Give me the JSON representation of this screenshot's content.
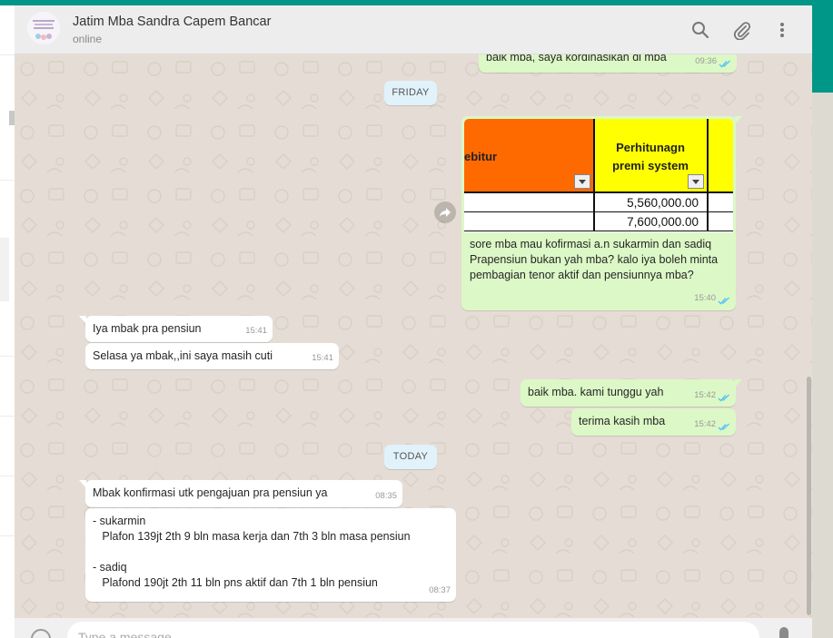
{
  "header": {
    "contact_name": "Jatim Mba Sandra Capem Bancar",
    "status": "online"
  },
  "icons": {
    "search": "search-icon",
    "attach": "paperclip-icon",
    "menu": "more-vertical-icon",
    "share": "forward-icon",
    "emoji": "emoji-icon",
    "mic": "microphone-icon"
  },
  "colors": {
    "teal": "#009688",
    "outgoing": "#dcf8c6",
    "incoming": "#ffffff",
    "tick_read": "#4fc3f7",
    "date_pill": "#e1f2fb"
  },
  "messages": {
    "m0": {
      "text": "baik mba, saya kordinasikan di mba",
      "time": "09:36"
    },
    "d1": {
      "label": "FRIDAY"
    },
    "m1": {
      "sheet": {
        "header_left": "ebitur",
        "header_right": "Perhitunagn premi system",
        "values": [
          "5,560,000.00",
          "7,600,000.00"
        ]
      },
      "text": "sore mba mau kofirmasi a.n sukarmin dan sadiq\nPrapensiun bukan yah mba? kalo iya boleh minta\npembagian tenor aktif dan pensiunnya mba?",
      "time": "15:40"
    },
    "m2": {
      "text": "Iya mbak pra pensiun",
      "time": "15:41"
    },
    "m3": {
      "text": "Selasa ya mbak,,ini saya masih cuti",
      "time": "15:41"
    },
    "m4": {
      "text": "baik mba. kami tunggu yah",
      "time": "15:42"
    },
    "m5": {
      "text": "terima kasih mba",
      "time": "15:42"
    },
    "d2": {
      "label": "TODAY"
    },
    "m6": {
      "text": "Mbak konfirmasi utk pengajuan pra pensiun ya",
      "time": "08:35"
    },
    "m7": {
      "text": "- sukarmin\n   Plafon 139jt 2th 9 bln masa kerja dan 7th 3 bln masa pensiun\n\n- sadiq\n   Plafond 190jt 2th 11 bln pns aktif dan 7th 1 bln pensiun",
      "time": "08:37"
    }
  },
  "composer": {
    "placeholder": "Type a message"
  }
}
